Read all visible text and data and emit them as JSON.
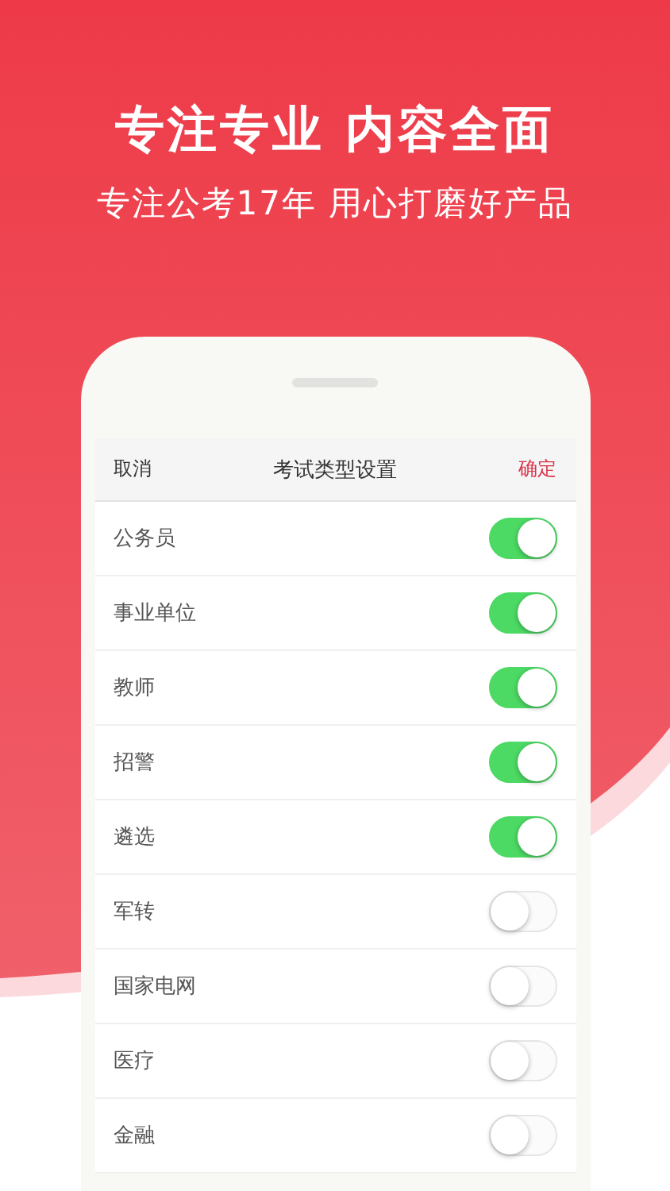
{
  "headline": "专注专业 内容全面",
  "subtitle": "专注公考17年 用心打磨好产品",
  "sheet": {
    "cancel": "取消",
    "title": "考试类型设置",
    "confirm": "确定"
  },
  "items": [
    {
      "label": "公务员",
      "on": true
    },
    {
      "label": "事业单位",
      "on": true
    },
    {
      "label": "教师",
      "on": true
    },
    {
      "label": "招警",
      "on": true
    },
    {
      "label": "遴选",
      "on": true
    },
    {
      "label": "军转",
      "on": false
    },
    {
      "label": "国家电网",
      "on": false
    },
    {
      "label": "医疗",
      "on": false
    },
    {
      "label": "金融",
      "on": false
    }
  ]
}
